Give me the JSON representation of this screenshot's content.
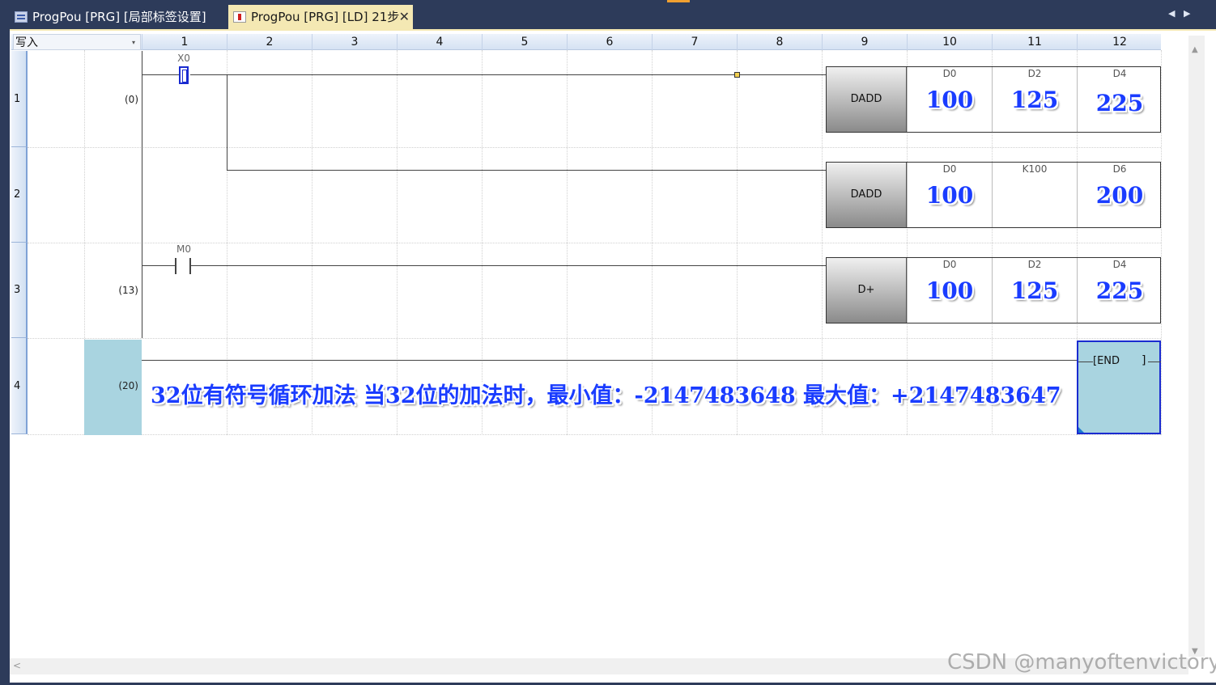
{
  "tabs": [
    {
      "label": "ProgPou [PRG] [局部标签设置]",
      "active": false
    },
    {
      "label": "ProgPou [PRG] [LD] 21步",
      "active": true
    }
  ],
  "tab_close": "✕",
  "nav": {
    "left": "◀",
    "right": "▶"
  },
  "mode": {
    "label": "写入",
    "arrow": "▾"
  },
  "columns": [
    "1",
    "2",
    "3",
    "4",
    "5",
    "6",
    "7",
    "8",
    "9",
    "10",
    "11",
    "12"
  ],
  "rows": [
    {
      "number": "1",
      "step": "(0)"
    },
    {
      "number": "2",
      "step": ""
    },
    {
      "number": "3",
      "step": "(13)"
    },
    {
      "number": "4",
      "step": "(20)"
    }
  ],
  "contacts": {
    "x0": "X0",
    "m0": "M0"
  },
  "instructions": [
    {
      "name": "DADD",
      "operands": [
        {
          "label": "D0",
          "value": "100"
        },
        {
          "label": "D2",
          "value": "125"
        },
        {
          "label": "D4",
          "value": "225"
        }
      ]
    },
    {
      "name": "DADD",
      "operands": [
        {
          "label": "D0",
          "value": "100"
        },
        {
          "label": "K100",
          "value": ""
        },
        {
          "label": "D6",
          "value": "200"
        }
      ]
    },
    {
      "name": "D+",
      "operands": [
        {
          "label": "D0",
          "value": "100"
        },
        {
          "label": "D2",
          "value": "125"
        },
        {
          "label": "D4",
          "value": "225"
        }
      ]
    }
  ],
  "end": {
    "label": "[END",
    "close": "]"
  },
  "comment": "32位有符号循环加法  当32位的加法时，最小值：-2147483648   最大值：+2147483647",
  "watermark": "CSDN @manyoftenvictory",
  "scroll": {
    "up": "▲",
    "down": "▼",
    "left": "<"
  }
}
